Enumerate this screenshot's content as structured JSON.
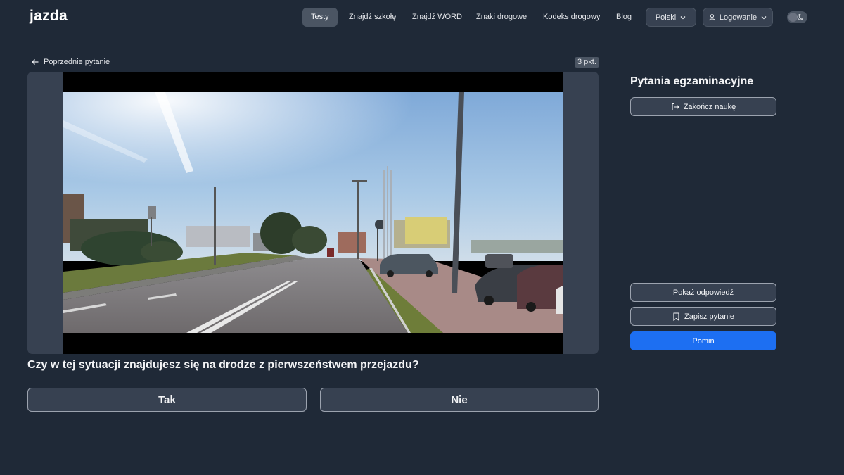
{
  "brand": {
    "logo_text": "jazda"
  },
  "nav": {
    "items": [
      {
        "label": "Testy",
        "active": true
      },
      {
        "label": "Znajdź szkołę"
      },
      {
        "label": "Znajdź WORD"
      },
      {
        "label": "Znaki drogowe"
      },
      {
        "label": "Kodeks drogowy"
      },
      {
        "label": "Blog"
      }
    ],
    "language": "Polski",
    "login": "Logowanie"
  },
  "question_nav": {
    "prev_label": "Poprzednie pytanie",
    "points": "3 pkt."
  },
  "media": {
    "type": "video",
    "scene": "road-intersection-dashcam"
  },
  "question": {
    "text": "Czy w tej sytuacji znajdujesz się na drodze z pierwszeństwem przejazdu?",
    "answers": [
      "Tak",
      "Nie"
    ]
  },
  "sidebar": {
    "title": "Pytania egzaminacyjne",
    "end_label": "Zakończ naukę",
    "show_answer_label": "Pokaż odpowiedź",
    "save_label": "Zapisz pytanie",
    "skip_label": "Pomiń"
  },
  "colors": {
    "background": "#1f2937",
    "primary": "#1d6ff2",
    "logo_accent": "#60a5fa",
    "button_bg": "#374151"
  }
}
